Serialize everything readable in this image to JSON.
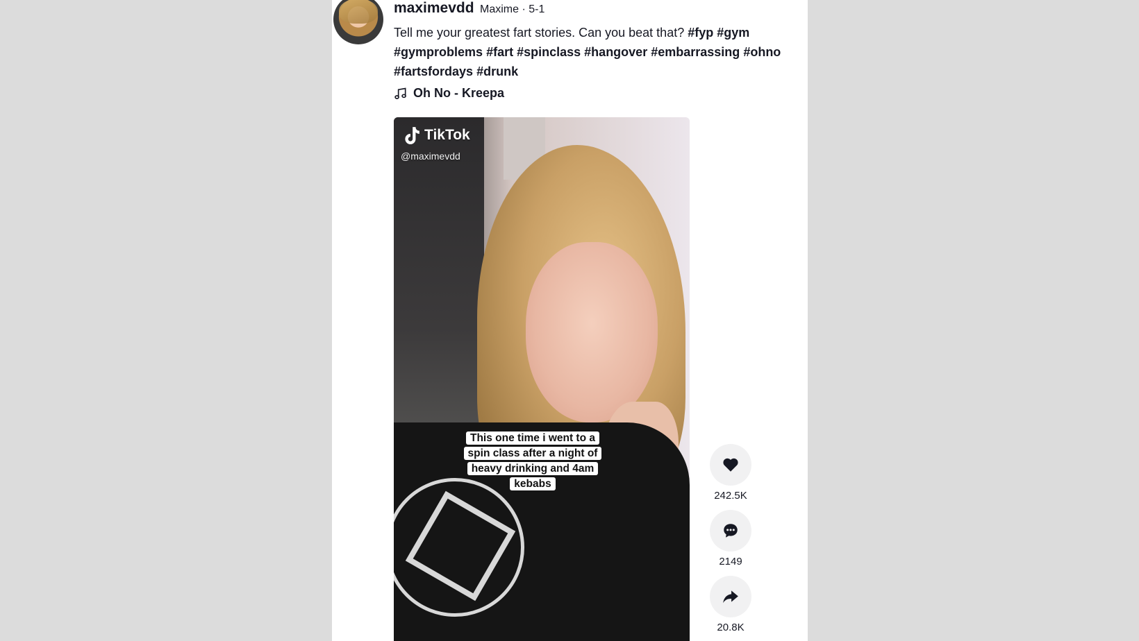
{
  "post": {
    "username": "maximevdd",
    "nickname": "Maxime · 5-1",
    "description_text": "Tell me your greatest fart stories. Can you beat that? ",
    "hashtags": [
      "#fyp",
      "#gym",
      "#gymproblems",
      "#fart",
      "#spinclass",
      "#hangover",
      "#embarrassing",
      "#ohno",
      "#fartsfordays",
      "#drunk"
    ],
    "music": "Oh No - Kreepa",
    "music_icon": "music-note-icon"
  },
  "video": {
    "brand": "TikTok",
    "brand_icon": "tiktok-logo-icon",
    "handle": "@maximevdd",
    "caption": "This one time i went to a spin class after a night of heavy drinking and 4am kebabs"
  },
  "actions": {
    "like": {
      "icon": "heart-icon",
      "count": "242.5K"
    },
    "comment": {
      "icon": "comment-icon",
      "count": "2149"
    },
    "share": {
      "icon": "share-icon",
      "count": "20.8K"
    }
  },
  "colors": {
    "background": "#dcdcdc",
    "text": "#161823",
    "button_bg": "#f1f1f2"
  }
}
